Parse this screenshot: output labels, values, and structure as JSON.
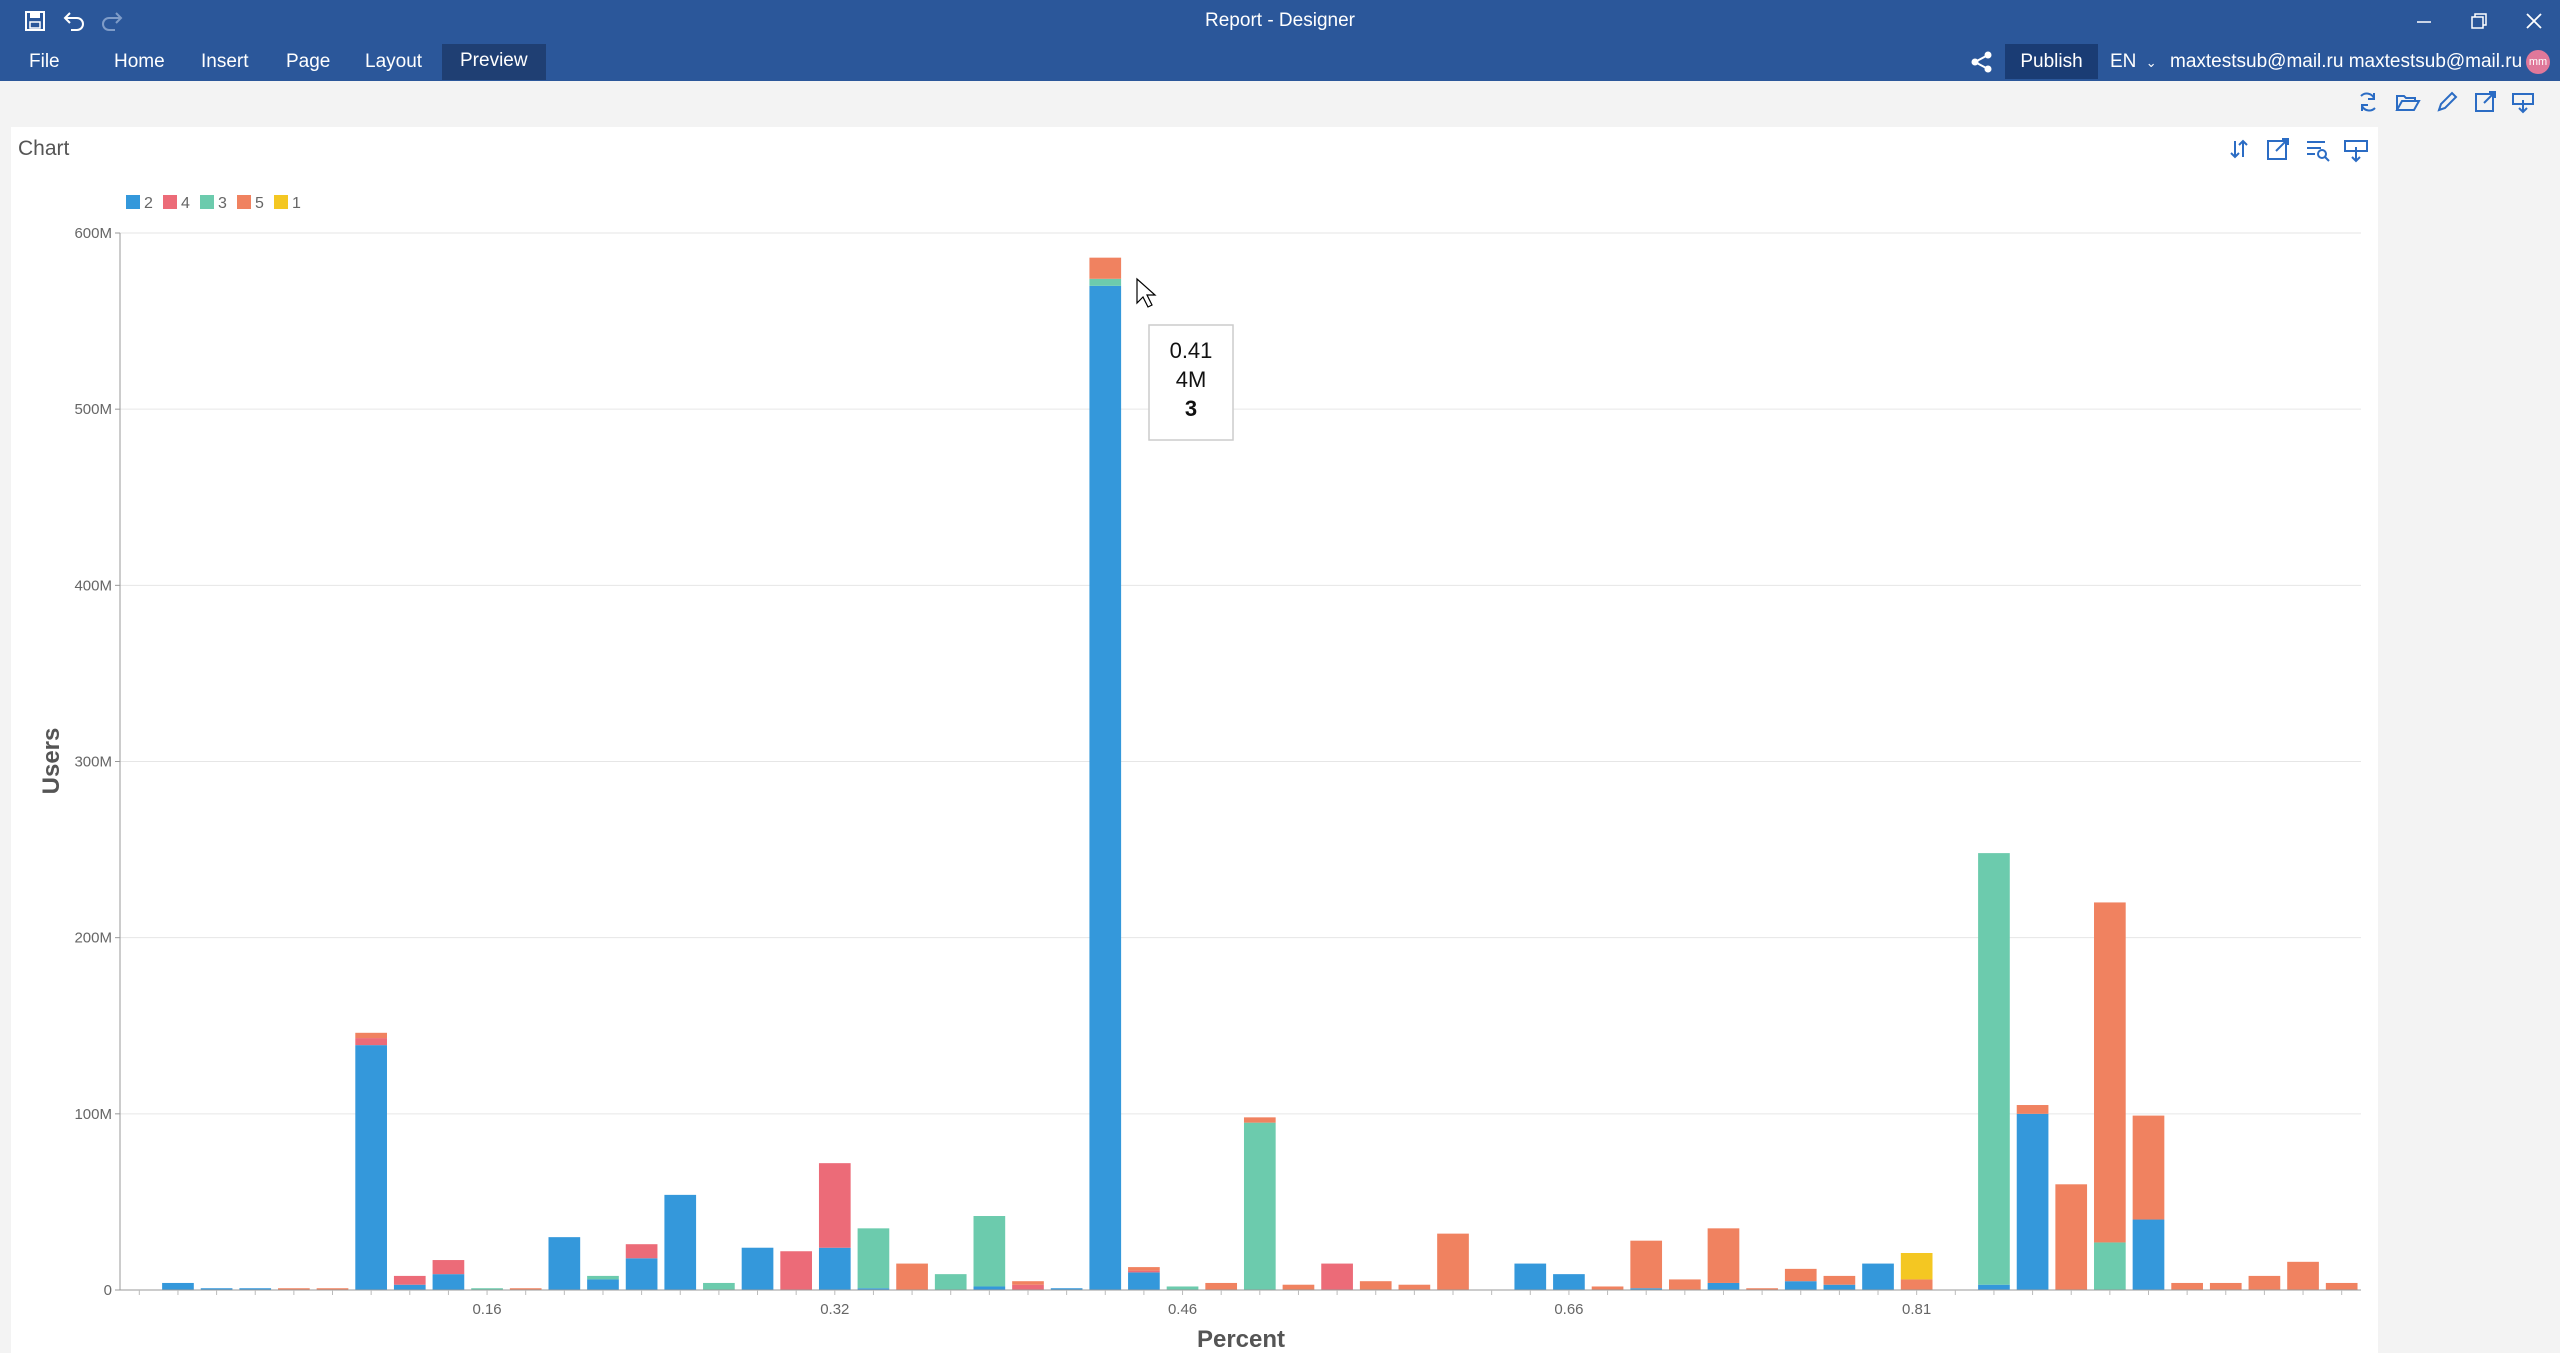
{
  "app": {
    "title": "Report - Designer",
    "menu": [
      "File",
      "Home",
      "Insert",
      "Page",
      "Layout",
      "Preview"
    ],
    "active_menu": "Preview",
    "publish_label": "Publish",
    "language": "EN",
    "user": "maxtestsub@mail.ru maxtestsub@mail.ru",
    "avatar_initials": "mm",
    "accent_color": "#2b579a"
  },
  "panel": {
    "title": "Chart"
  },
  "tooltip": {
    "x": "0.41",
    "value": "4M",
    "series": "3"
  },
  "chart_data": {
    "type": "bar",
    "stacked": true,
    "xlabel": "Percent",
    "ylabel": "Users",
    "ylim": [
      0,
      600000000
    ],
    "y_ticks": [
      "0",
      "100M",
      "200M",
      "300M",
      "400M",
      "500M",
      "600M"
    ],
    "x_ticks": [
      "0.16",
      "0.32",
      "0.46",
      "0.66",
      "0.81"
    ],
    "legend_position": "top-left",
    "grid": true,
    "series": [
      {
        "name": "2",
        "color": "#3498db",
        "values": [
          0,
          4,
          1,
          1,
          0,
          0,
          139,
          3,
          9,
          0,
          0,
          30,
          6,
          18,
          54,
          0,
          24,
          0,
          24,
          1,
          0,
          0,
          2,
          0,
          1,
          570,
          10,
          0,
          0,
          0,
          0,
          0,
          0,
          0,
          0,
          0,
          15,
          9,
          0,
          1,
          0,
          4,
          0,
          5,
          3,
          15,
          0,
          0,
          3,
          100,
          0,
          0,
          40,
          0,
          0,
          0,
          0,
          0
        ]
      },
      {
        "name": "4",
        "color": "#ec6b78",
        "values": [
          0,
          0,
          0,
          0,
          0,
          0,
          4,
          5,
          8,
          0,
          0,
          0,
          0,
          8,
          0,
          0,
          0,
          22,
          48,
          0,
          0,
          0,
          0,
          3,
          0,
          0,
          1,
          0,
          0,
          0,
          0,
          15,
          0,
          0,
          0,
          0,
          0,
          0,
          0,
          0,
          0,
          0,
          0,
          0,
          0,
          0,
          0,
          0,
          0,
          0,
          0,
          0,
          0,
          0,
          0,
          0,
          0,
          0
        ]
      },
      {
        "name": "3",
        "color": "#6ccbad",
        "values": [
          0,
          0,
          0,
          0,
          0,
          0,
          0,
          0,
          0,
          1,
          0,
          0,
          2,
          0,
          0,
          4,
          0,
          0,
          0,
          34,
          0,
          9,
          40,
          0,
          0,
          4,
          0,
          2,
          0,
          95,
          0,
          0,
          0,
          0,
          0,
          0,
          0,
          0,
          0,
          0,
          0,
          0,
          0,
          0,
          0,
          0,
          0,
          0,
          245,
          0,
          0,
          27,
          0,
          0,
          0,
          0,
          0,
          0
        ]
      },
      {
        "name": "5",
        "color": "#f08260",
        "values": [
          0,
          0,
          0,
          0,
          1,
          1,
          3,
          0,
          0,
          0,
          1,
          0,
          0,
          0,
          0,
          0,
          0,
          0,
          0,
          0,
          15,
          0,
          0,
          2,
          0,
          12,
          2,
          0,
          4,
          3,
          3,
          0,
          5,
          3,
          32,
          0,
          0,
          0,
          2,
          27,
          6,
          31,
          1,
          7,
          5,
          0,
          6,
          0,
          0,
          5,
          60,
          193,
          59,
          4,
          4,
          8,
          16,
          4
        ]
      },
      {
        "name": "1",
        "color": "#f4c722",
        "values": [
          0,
          0,
          0,
          0,
          0,
          0,
          0,
          0,
          0,
          0,
          0,
          0,
          0,
          0,
          0,
          0,
          0,
          0,
          0,
          0,
          0,
          0,
          0,
          0,
          0,
          0,
          0,
          0,
          0,
          0,
          0,
          0,
          0,
          0,
          0,
          0,
          0,
          0,
          0,
          0,
          0,
          0,
          0,
          0,
          0,
          0,
          15,
          0,
          0,
          0,
          0,
          0,
          0,
          0,
          0,
          0,
          0,
          0
        ]
      }
    ],
    "value_unit": "M"
  }
}
